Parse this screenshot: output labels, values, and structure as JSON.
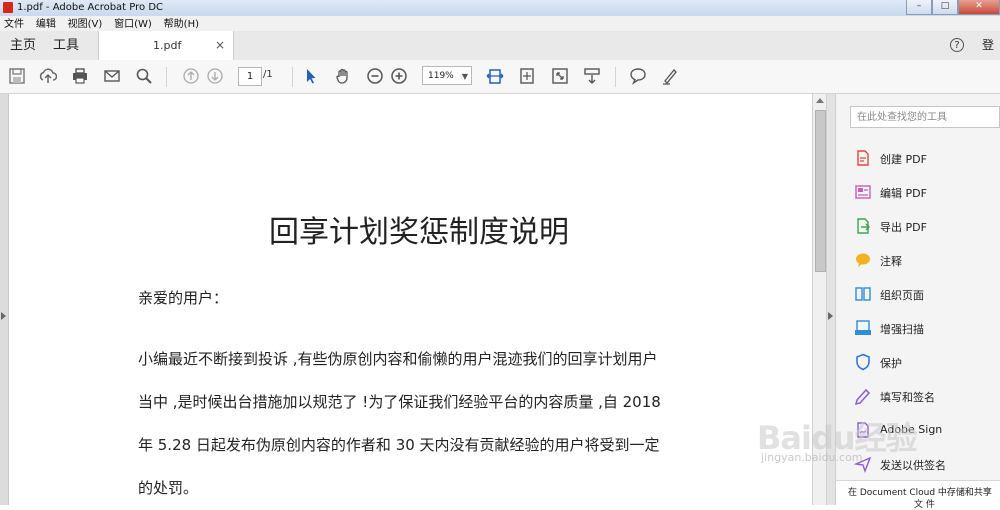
{
  "window": {
    "title": "1.pdf - Adobe Acrobat Pro DC",
    "buttons": [
      "–",
      "□",
      "✕"
    ]
  },
  "menubar": [
    "文件",
    "编辑",
    "视图(V)",
    "窗口(W)",
    "帮助(H)"
  ],
  "nav": {
    "home": "主页",
    "tools": "工具",
    "help": "?",
    "login": "登录"
  },
  "doc_tab": {
    "name": "1.pdf",
    "close": "×"
  },
  "toolbar": {
    "page_current": "1",
    "page_total": "/1",
    "zoom": "119%",
    "icons": [
      "save-icon",
      "cloud-upload-icon",
      "print-icon",
      "email-icon",
      "search-icon",
      "page-up-icon",
      "page-down-icon",
      "select-arrow-icon",
      "hand-icon",
      "zoom-out-icon",
      "zoom-in-icon",
      "fit-width-icon",
      "fit-page-icon",
      "full-screen-icon",
      "scroll-mode-icon",
      "comment-icon",
      "highlight-pen-icon"
    ]
  },
  "document": {
    "title": "回享计划奖惩制度说明",
    "greeting": "亲爱的用户：",
    "paragraph_lines": [
      "小编最近不断接到投诉 ,有些伪原创内容和偷懒的用户混迹我们的回享计划用户",
      "当中 ,是时候出台措施加以规范了 !为了保证我们经验平台的内容质量 ,自 2018",
      "年 5.28 日起发布伪原创内容的作者和 30 天内没有贡献经验的用户将受到一定",
      "的处罚。"
    ]
  },
  "right_pane": {
    "search_placeholder": "在此处查找您的工具",
    "tools": [
      {
        "label": "创建 PDF",
        "icon": "create-pdf-icon",
        "color": "#e2473b"
      },
      {
        "label": "编辑 PDF",
        "icon": "edit-pdf-icon",
        "color": "#c75fb5"
      },
      {
        "label": "导出 PDF",
        "icon": "export-pdf-icon",
        "color": "#3fa34d"
      },
      {
        "label": "注释",
        "icon": "comment-icon",
        "color": "#f0b323"
      },
      {
        "label": "组织页面",
        "icon": "organize-pages-icon",
        "color": "#2b8fd6"
      },
      {
        "label": "增强扫描",
        "icon": "enhance-scan-icon",
        "color": "#2b8fd6"
      },
      {
        "label": "保护",
        "icon": "protect-icon",
        "color": "#2b6fd6"
      },
      {
        "label": "填写和签名",
        "icon": "fill-sign-icon",
        "color": "#8a5bd6"
      },
      {
        "label": "Adobe Sign",
        "icon": "adobe-sign-icon",
        "color": "#8a5bd6"
      },
      {
        "label": "发送以供签名",
        "icon": "send-sign-icon",
        "color": "#8a5bd6"
      }
    ],
    "bottom_line1": "在 Document Cloud 中存储和共享",
    "bottom_line2": "文 件"
  },
  "watermark": {
    "brand": "Baidu经验",
    "url": "jingyan.baidu.com"
  }
}
